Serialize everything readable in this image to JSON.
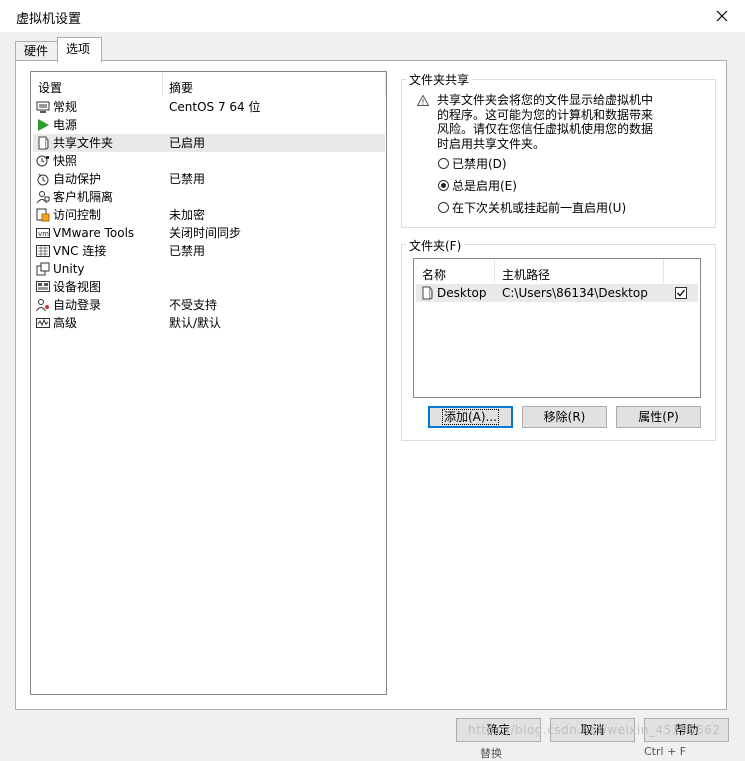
{
  "window": {
    "title": "虚拟机设置",
    "close_icon": "close-icon"
  },
  "tabs": [
    {
      "label": "硬件"
    },
    {
      "label": "选项"
    }
  ],
  "settings_list": {
    "header_setting": "设置",
    "header_summary": "摘要",
    "items": [
      {
        "name": "常规",
        "value": "CentOS 7 64 位",
        "icon": "general-icon"
      },
      {
        "name": "电源",
        "value": "",
        "icon": "power-play-icon"
      },
      {
        "name": "共享文件夹",
        "value": "已启用",
        "icon": "shared-folder-icon"
      },
      {
        "name": "快照",
        "value": "",
        "icon": "snapshot-icon"
      },
      {
        "name": "自动保护",
        "value": "已禁用",
        "icon": "autoprotect-icon"
      },
      {
        "name": "客户机隔离",
        "value": "",
        "icon": "isolation-icon"
      },
      {
        "name": "访问控制",
        "value": "未加密",
        "icon": "access-control-icon"
      },
      {
        "name": "VMware Tools",
        "value": "关闭时间同步",
        "icon": "vmware-tools-icon"
      },
      {
        "name": "VNC 连接",
        "value": "已禁用",
        "icon": "vnc-icon"
      },
      {
        "name": "Unity",
        "value": "",
        "icon": "unity-icon"
      },
      {
        "name": "设备视图",
        "value": "",
        "icon": "device-view-icon"
      },
      {
        "name": "自动登录",
        "value": "不受支持",
        "icon": "autologin-icon"
      },
      {
        "name": "高级",
        "value": "默认/默认",
        "icon": "advanced-icon"
      }
    ]
  },
  "folder_sharing": {
    "title": "文件夹共享",
    "warning_icon": "warning-icon",
    "warning_line1": "共享文件夹会将您的文件显示给虚拟机中",
    "warning_line2": "的程序。这可能为您的计算机和数据带来",
    "warning_line3": "风险。请仅在您信任虚拟机使用您的数据",
    "warning_line4": "时启用共享文件夹。",
    "options": [
      {
        "label": "已禁用(D)",
        "checked": false
      },
      {
        "label": "总是启用(E)",
        "checked": true
      },
      {
        "label": "在下次关机或挂起前一直启用(U)",
        "checked": false
      }
    ]
  },
  "folders": {
    "title": "文件夹(F)",
    "header_name": "名称",
    "header_path": "主机路径",
    "rows": [
      {
        "name": "Desktop",
        "path": "C:\\Users\\86134\\Desktop",
        "enabled": true
      }
    ],
    "add_label": "添加(A)...",
    "remove_label": "移除(R)",
    "properties_label": "属性(P)"
  },
  "footer": {
    "ok_label": "确定",
    "cancel_label": "取消",
    "help_label": "帮助",
    "bg_text": "替换",
    "bg_shortcut": "Ctrl + F"
  },
  "watermark": "https://blog.csdn.net/weixin_45396562"
}
